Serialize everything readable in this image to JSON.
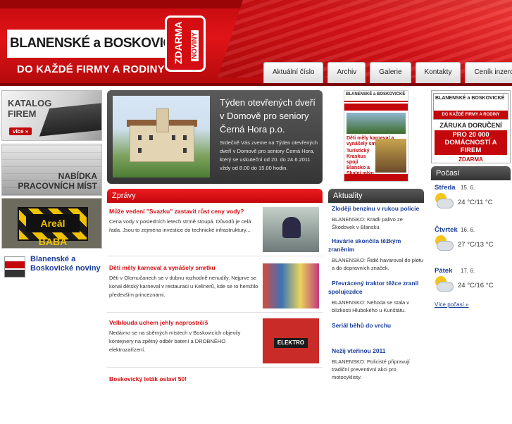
{
  "header": {
    "logo_title": "BLANENSKÉ a BOSKOVICKÉ",
    "logo_badge": "ZDARMA",
    "logo_badge_small": "NOVINY",
    "logo_subtitle": "DO KAŽDÉ FIRMY A RODINY",
    "nav": [
      "Aktuální číslo",
      "Archiv",
      "Galerie",
      "Kontakty",
      "Ceník inzerce"
    ]
  },
  "left": {
    "katalog_line1": "KATALOG",
    "katalog_line2": "FIREM",
    "katalog_more": "více »",
    "nabidka_line1": "NABÍDKA",
    "nabidka_line2": "PRACOVNÍCH MÍST",
    "areal": "Areál BABA",
    "paper_link": "Blanenské a Boskovické noviny"
  },
  "feature": {
    "title": "Týden otevřených dveří v Domově pro seniory Černá Hora p.o.",
    "text": "Srdečně Vás zveme na Týden otevřených dveří v Domově pro seniory Černá Hora, který se uskuteční od 20. do 24.6.2011 vždy od 8.00 do 15.00 hodin."
  },
  "cover": {
    "mast": "BLANENSKÉ a BOSKOVICKÉ",
    "headline1": "Děti měly karneval a vynášely smrtku",
    "headline2": "Turistický Kraskus spojí Blansko a Skalní mlýn"
  },
  "promo": {
    "mini_title": "BLANENSKÉ a BOSKOVICKÉ",
    "mini_sub": "DO KAŽDÉ FIRMY A RODINY",
    "line1": "ZÁRUKA DORUČENÍ",
    "line2": "PRO 20 000 DOMÁCNOSTÍ A FIREM",
    "line3": "ZDARMA"
  },
  "sections": {
    "zpravy": "Zprávy",
    "aktuality": "Aktuality",
    "pocasi": "Počasí"
  },
  "news": [
    {
      "title": "Může vedení \"Svazku\" zastavit růst ceny vody?",
      "text": "Cena vody v posledních letech strmě stoupá. Důvodů je celá řada. Jsou to zejména investice do technické infrastruktury..."
    },
    {
      "title": "Děti měly karneval a vynášely smrtku",
      "text": "Děti v Olomučanech se v dubnu rozhodně nenudily. Nejprve se konal dětský karneval v restauraci u Kellnerů, kde se to hemžilo především princeznami."
    },
    {
      "title": "Velblouda uchem jehly neprostrčíš",
      "text": "Nedávno se na sběrných místech v Boskovicích objevily kontejnery na zpětný odběr baterií a DROBNÉHO elektrozařízení.",
      "img_label": "ELEKTRO"
    },
    {
      "title": "Boskovický leták oslaví 50!",
      "text": ""
    }
  ],
  "aktuality": [
    {
      "title": "Zloději benzínu v rukou policie",
      "text": "BLANENSKO: Kradli palivo ze Škodovek v Blansku."
    },
    {
      "title": "Havárie skončila těžkým zraněním",
      "text": "BLANENSKO: Řidič havaroval do plotu a do dopravních značek."
    },
    {
      "title": "Převrácený traktor těžce zranil spolujezdce",
      "text": "BLANENSKO: Nehoda se stala v blízkosti Hlubokého u Kunštátu."
    },
    {
      "title": "Seriál běhů do vrchu",
      "text": ""
    },
    {
      "title": "Nežij vteřinou 2011",
      "text": "BLANENSKO: Policisté připravují tradiční preventivní akci pro motocyklisty."
    }
  ],
  "pocasi": [
    {
      "day": "Středa",
      "date": "15. 6.",
      "temp": "24 °C/11 °C",
      "icon": "cloud-sun-icon"
    },
    {
      "day": "Čtvrtek",
      "date": "16. 6.",
      "temp": "27 °C/13 °C",
      "icon": "cloud-sun-icon"
    },
    {
      "day": "Pátek",
      "date": "17. 6.",
      "temp": "24 °C/16 °C",
      "icon": "cloud-sun-icon"
    }
  ],
  "pocasi_more": "Více počasí »",
  "colors": {
    "brand_red": "#c3070b",
    "link_blue": "#1a3d9b",
    "dark_panel": "#353535"
  }
}
